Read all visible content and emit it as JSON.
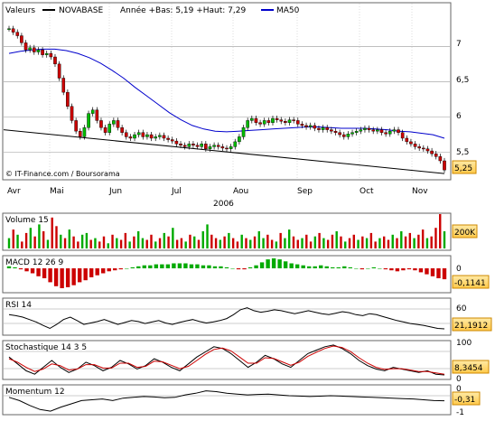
{
  "chart_data": [
    {
      "type": "candlestick",
      "title": "Valeurs",
      "ticker": "NOVABASE",
      "stats": "Année +Bas: 5,19 +Haut: 7,29",
      "legend_items": [
        {
          "name": "NOVABASE",
          "color": "#000000"
        },
        {
          "name": "MA50",
          "color": "#0000cc"
        }
      ],
      "watermark": "© IT-Finance.com / Boursorama",
      "x_labels": [
        "Avr",
        "Mai",
        "Jun",
        "Jul",
        "Aou",
        "Sep",
        "Oct",
        "Nov"
      ],
      "year_label": "2006",
      "y_ticks": [
        "7",
        "6,5",
        "6",
        "5,5"
      ],
      "ylim": [
        5.15,
        7.4
      ],
      "last_value": "5,25",
      "grid": true,
      "price_series": [
        7.25,
        7.2,
        7.15,
        7.05,
        6.95,
        6.98,
        6.92,
        6.95,
        6.88,
        6.9,
        6.85,
        6.75,
        6.55,
        6.35,
        6.15,
        5.95,
        5.8,
        5.72,
        5.85,
        6.05,
        6.1,
        5.95,
        5.85,
        5.78,
        5.9,
        5.95,
        5.85,
        5.78,
        5.72,
        5.7,
        5.75,
        5.78,
        5.72,
        5.75,
        5.7,
        5.72,
        5.74,
        5.7,
        5.68,
        5.66,
        5.62,
        5.6,
        5.58,
        5.62,
        5.6,
        5.58,
        5.62,
        5.55,
        5.58,
        5.6,
        5.58,
        5.56,
        5.55,
        5.58,
        5.65,
        5.72,
        5.85,
        5.95,
        5.98,
        5.92,
        5.9,
        5.95,
        5.92,
        5.98,
        5.96,
        5.94,
        5.92,
        5.96,
        5.95,
        5.9,
        5.88,
        5.86,
        5.88,
        5.84,
        5.82,
        5.85,
        5.82,
        5.8,
        5.78,
        5.75,
        5.72,
        5.76,
        5.78,
        5.8,
        5.82,
        5.84,
        5.82,
        5.8,
        5.82,
        5.78,
        5.76,
        5.8,
        5.82,
        5.78,
        5.7,
        5.65,
        5.62,
        5.58,
        5.56,
        5.55,
        5.52,
        5.48,
        5.44,
        5.38,
        5.25
      ],
      "ma50_series": [
        6.9,
        6.93,
        6.95,
        6.96,
        6.96,
        6.94,
        6.9,
        6.84,
        6.76,
        6.66,
        6.55,
        6.42,
        6.3,
        6.18,
        6.06,
        5.96,
        5.88,
        5.83,
        5.8,
        5.79,
        5.8,
        5.81,
        5.82,
        5.83,
        5.84,
        5.85,
        5.86,
        5.86,
        5.85,
        5.84,
        5.84,
        5.84,
        5.83,
        5.82,
        5.8,
        5.79,
        5.77,
        5.75,
        5.7
      ],
      "trendline": [
        5.82,
        5.2
      ]
    },
    {
      "type": "bar",
      "title": "Volume 15",
      "last_value": "200K",
      "up_color": "#00aa00",
      "down_color": "#cc0000",
      "values": [
        30,
        55,
        40,
        20,
        45,
        60,
        35,
        70,
        50,
        25,
        90,
        65,
        40,
        30,
        55,
        35,
        20,
        40,
        45,
        25,
        30,
        20,
        35,
        15,
        40,
        30,
        25,
        45,
        20,
        35,
        50,
        30,
        25,
        40,
        20,
        30,
        45,
        35,
        60,
        25,
        30,
        20,
        40,
        35,
        25,
        50,
        70,
        40,
        30,
        25,
        35,
        45,
        30,
        20,
        40,
        30,
        25,
        35,
        50,
        30,
        40,
        25,
        20,
        45,
        30,
        55,
        35,
        25,
        30,
        40,
        20,
        35,
        45,
        30,
        25,
        40,
        50,
        35,
        20,
        30,
        40,
        25,
        35,
        30,
        45,
        20,
        30,
        35,
        25,
        40,
        30,
        50,
        35,
        45,
        30,
        40,
        55,
        30,
        35,
        60,
        100,
        50
      ],
      "up_flags": [
        1,
        0,
        1,
        0,
        0,
        1,
        0,
        1,
        0,
        1,
        0,
        0,
        1,
        0,
        1,
        0,
        0,
        1,
        1,
        0,
        1,
        0,
        0,
        1,
        0,
        1,
        0,
        0,
        1,
        0,
        1,
        1,
        0,
        0,
        1,
        0,
        1,
        0,
        1,
        0,
        0,
        1,
        0,
        1,
        0,
        1,
        1,
        0,
        0,
        1,
        0,
        1,
        0,
        0,
        1,
        0,
        1,
        0,
        1,
        1,
        0,
        0,
        1,
        0,
        1,
        1,
        0,
        0,
        1,
        0,
        0,
        1,
        0,
        1,
        0,
        0,
        1,
        0,
        1,
        0,
        0,
        1,
        0,
        1,
        0,
        0,
        1,
        0,
        0,
        1,
        0,
        1,
        0,
        0,
        1,
        0,
        0,
        1,
        0,
        0,
        0,
        1
      ]
    },
    {
      "type": "bar",
      "title": "MACD 12 26 9",
      "y_ticks": [
        "0"
      ],
      "last_value": "-0,1141",
      "values": [
        0.02,
        0.01,
        -0.01,
        -0.03,
        -0.05,
        -0.08,
        -0.1,
        -0.14,
        -0.18,
        -0.2,
        -0.19,
        -0.17,
        -0.14,
        -0.12,
        -0.09,
        -0.07,
        -0.05,
        -0.03,
        -0.02,
        -0.01,
        0.0,
        0.01,
        0.02,
        0.03,
        0.03,
        0.04,
        0.04,
        0.04,
        0.05,
        0.05,
        0.05,
        0.04,
        0.04,
        0.03,
        0.03,
        0.02,
        0.02,
        0.01,
        0.0,
        -0.01,
        -0.01,
        0.01,
        0.03,
        0.06,
        0.09,
        0.1,
        0.09,
        0.07,
        0.05,
        0.04,
        0.03,
        0.02,
        0.02,
        0.03,
        0.02,
        0.01,
        0.01,
        0.02,
        0.01,
        0.0,
        -0.01,
        0.0,
        0.01,
        0.0,
        -0.01,
        -0.02,
        -0.03,
        -0.02,
        -0.01,
        -0.02,
        -0.04,
        -0.06,
        -0.08,
        -0.1,
        -0.11
      ]
    },
    {
      "type": "line",
      "title": "RSI 14",
      "y_ticks": [
        "60"
      ],
      "last_value": "21,1912",
      "values": [
        50,
        48,
        45,
        40,
        35,
        28,
        22,
        30,
        40,
        45,
        38,
        30,
        33,
        36,
        40,
        35,
        30,
        34,
        38,
        36,
        32,
        35,
        38,
        33,
        30,
        34,
        37,
        40,
        36,
        33,
        35,
        38,
        42,
        50,
        60,
        64,
        58,
        55,
        57,
        60,
        58,
        55,
        52,
        55,
        58,
        55,
        52,
        50,
        53,
        56,
        54,
        50,
        48,
        52,
        50,
        46,
        42,
        38,
        35,
        32,
        30,
        28,
        25,
        22,
        21
      ]
    },
    {
      "type": "line",
      "title": "Stochastique 14 3 5",
      "y_ticks": [
        "100",
        "0"
      ],
      "last_value": "8,3454",
      "series": [
        {
          "name": "",
          "color": "#000000",
          "values": [
            60,
            40,
            20,
            10,
            30,
            50,
            30,
            15,
            25,
            45,
            35,
            20,
            30,
            50,
            40,
            25,
            35,
            55,
            45,
            30,
            20,
            40,
            60,
            75,
            90,
            85,
            70,
            50,
            30,
            45,
            65,
            55,
            40,
            30,
            50,
            70,
            80,
            90,
            95,
            85,
            70,
            50,
            35,
            25,
            20,
            30,
            25,
            20,
            15,
            20,
            10,
            8
          ]
        },
        {
          "name": "",
          "color": "#cc0000",
          "values": [
            55,
            45,
            30,
            18,
            25,
            40,
            35,
            22,
            25,
            38,
            38,
            28,
            28,
            42,
            42,
            30,
            33,
            48,
            46,
            36,
            26,
            33,
            50,
            68,
            82,
            86,
            78,
            60,
            42,
            42,
            58,
            56,
            46,
            36,
            45,
            62,
            74,
            85,
            92,
            88,
            76,
            58,
            42,
            30,
            24,
            26,
            26,
            22,
            18,
            18,
            14,
            10
          ]
        }
      ]
    },
    {
      "type": "line",
      "title": "Momentum 12",
      "y_ticks": [
        "0",
        "-1"
      ],
      "last_value": "-0,31",
      "values": [
        -0.1,
        -0.3,
        -0.6,
        -0.85,
        -0.95,
        -0.7,
        -0.5,
        -0.3,
        -0.25,
        -0.2,
        -0.3,
        -0.15,
        -0.1,
        -0.05,
        -0.08,
        -0.12,
        -0.1,
        0.05,
        0.15,
        0.3,
        0.25,
        0.15,
        0.1,
        0.05,
        0.08,
        0.1,
        0.05,
        0.0,
        -0.02,
        -0.05,
        -0.03,
        0.0,
        -0.02,
        -0.05,
        -0.08,
        -0.1,
        -0.12,
        -0.15,
        -0.18,
        -0.2,
        -0.25,
        -0.3,
        -0.31
      ]
    }
  ]
}
